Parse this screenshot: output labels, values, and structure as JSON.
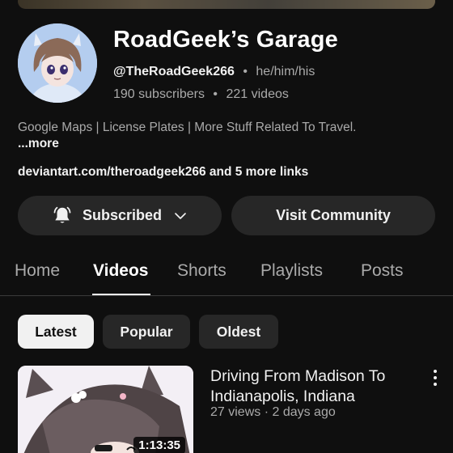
{
  "channel": {
    "name": "RoadGeek’s Garage",
    "handle": "@TheRoadGeek266",
    "pronouns": "he/him/his",
    "subscribers": "190 subscribers",
    "videos_count": "221 videos",
    "description": "Google Maps | License Plates | More Stuff Related To Travel.",
    "more_label": "...more",
    "links": "deviantart.com/theroadgeek266 and 5 more links"
  },
  "separator": "•",
  "actions": {
    "subscribed_label": "Subscribed",
    "community_label": "Visit Community"
  },
  "tabs": [
    {
      "label": "Home"
    },
    {
      "label": "Videos"
    },
    {
      "label": "Shorts"
    },
    {
      "label": "Playlists"
    },
    {
      "label": "Posts"
    }
  ],
  "active_tab": "Videos",
  "filters": [
    {
      "label": "Latest"
    },
    {
      "label": "Popular"
    },
    {
      "label": "Oldest"
    }
  ],
  "active_filter": "Latest",
  "video": {
    "title": "Driving From Madison To Indianapolis, Indiana",
    "meta": "27 views · 2 days ago",
    "duration": "1:13:35"
  },
  "icons": {
    "bell": "bell-icon",
    "chevron": "chevron-down-icon",
    "more": "more-vert-icon"
  },
  "colors": {
    "background": "#0f0f0f",
    "button": "#272727",
    "text_primary": "#f1f1f1",
    "text_secondary": "#aaaaaa"
  }
}
